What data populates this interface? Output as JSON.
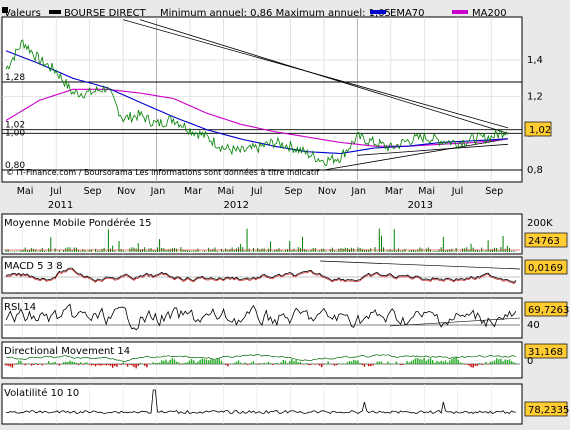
{
  "main": {
    "legend_label": "Valeurs",
    "series_name": "BOURSE DIRECT",
    "min_max_text": "Minimum annuel: 0,86 Maximum annuel: 1,05",
    "ema_label": "EMA70",
    "ma_label": "MA200",
    "copyright": "© IT-Finance.com / Boursorama Les informations sont données à titre indicatif",
    "y_ticks": [
      "1,4",
      "1,2",
      "1",
      "0,8"
    ],
    "annotations": [
      "1,28",
      "1,02",
      "1,00",
      "0,80"
    ],
    "last_value": "1,02",
    "colors": {
      "price": "#008000",
      "ema": "#0000cc",
      "ma": "#cc00cc",
      "highlight": "#ffcc33"
    }
  },
  "x_axis": {
    "months": [
      "Mai",
      "Jul",
      "Sep",
      "Nov",
      "Jan",
      "Mar",
      "Mai",
      "Jul",
      "Sep",
      "Nov",
      "Jan",
      "Mar",
      "Mai",
      "Jul",
      "Sep"
    ],
    "years": [
      "2011",
      "2012",
      "2013"
    ]
  },
  "panels": {
    "volume": {
      "title": "Moyenne Mobile Pondérée 15",
      "axis_label": "200K",
      "value": "24763"
    },
    "macd": {
      "title": "MACD 5 3 8",
      "value": "0,0169"
    },
    "rsi": {
      "title": "RSI 14",
      "axis_label": "40",
      "value": "69,7263"
    },
    "dm": {
      "title": "Directional Movement 14",
      "axis_label": "0",
      "value": "31,168"
    },
    "vol": {
      "title": "Volatilité 10 10",
      "value": "78,2335"
    }
  },
  "chart_data": [
    {
      "type": "line",
      "title": "",
      "series": [
        {
          "name": "BOURSE DIRECT",
          "points": [
            [
              "2011-04",
              1.35
            ],
            [
              "2011-05",
              1.5
            ],
            [
              "2011-06",
              1.4
            ],
            [
              "2011-07",
              1.34
            ],
            [
              "2011-08",
              1.22
            ],
            [
              "2011-09",
              1.22
            ],
            [
              "2011-10",
              1.25
            ],
            [
              "2011-11",
              1.08
            ],
            [
              "2011-12",
              1.1
            ],
            [
              "2012-01",
              1.05
            ],
            [
              "2012-02",
              1.08
            ],
            [
              "2012-03",
              1.02
            ],
            [
              "2012-04",
              0.98
            ],
            [
              "2012-05",
              0.92
            ],
            [
              "2012-06",
              0.9
            ],
            [
              "2012-07",
              0.92
            ],
            [
              "2012-08",
              0.95
            ],
            [
              "2012-09",
              0.93
            ],
            [
              "2012-10",
              0.89
            ],
            [
              "2012-11",
              0.85
            ],
            [
              "2012-12",
              0.87
            ],
            [
              "2013-01",
              0.98
            ],
            [
              "2013-02",
              0.95
            ],
            [
              "2013-03",
              0.92
            ],
            [
              "2013-04",
              0.96
            ],
            [
              "2013-05",
              0.98
            ],
            [
              "2013-06",
              0.96
            ],
            [
              "2013-07",
              0.95
            ],
            [
              "2013-08",
              0.97
            ],
            [
              "2013-09",
              0.98
            ],
            [
              "2013-10",
              1.02
            ]
          ]
        },
        {
          "name": "EMA70",
          "points": [
            [
              "2011-04",
              1.45
            ],
            [
              "2011-06",
              1.38
            ],
            [
              "2011-08",
              1.3
            ],
            [
              "2011-10",
              1.25
            ],
            [
              "2011-12",
              1.17
            ],
            [
              "2012-02",
              1.09
            ],
            [
              "2012-04",
              1.02
            ],
            [
              "2012-06",
              0.97
            ],
            [
              "2012-08",
              0.93
            ],
            [
              "2012-10",
              0.9
            ],
            [
              "2012-12",
              0.89
            ],
            [
              "2013-02",
              0.92
            ],
            [
              "2013-04",
              0.93
            ],
            [
              "2013-06",
              0.95
            ],
            [
              "2013-08",
              0.96
            ],
            [
              "2013-10",
              0.97
            ]
          ]
        },
        {
          "name": "MA200",
          "points": [
            [
              "2011-04",
              1.07
            ],
            [
              "2011-06",
              1.18
            ],
            [
              "2011-08",
              1.24
            ],
            [
              "2011-10",
              1.24
            ],
            [
              "2011-12",
              1.22
            ],
            [
              "2012-02",
              1.19
            ],
            [
              "2012-04",
              1.11
            ],
            [
              "2012-06",
              1.05
            ],
            [
              "2012-08",
              1.01
            ],
            [
              "2012-10",
              0.98
            ],
            [
              "2012-12",
              0.95
            ],
            [
              "2013-02",
              0.93
            ],
            [
              "2013-04",
              0.93
            ],
            [
              "2013-06",
              0.94
            ],
            [
              "2013-08",
              0.95
            ],
            [
              "2013-10",
              0.97
            ]
          ]
        }
      ],
      "horizontal_levels": [
        1.28,
        1.02,
        1.0,
        0.8
      ],
      "ylim": [
        0.8,
        1.58
      ],
      "y_ticks": [
        1.4,
        1.2,
        1.0,
        0.8
      ],
      "x_range": [
        "2011-04",
        "2013-10"
      ],
      "grid": true
    },
    {
      "type": "bar",
      "title": "Moyenne Mobile Pondérée 15",
      "last_value": 24763
    },
    {
      "type": "line",
      "title": "MACD 5 3 8",
      "last_value": 0.0169
    },
    {
      "type": "line",
      "title": "RSI 14",
      "last_value": 69.7263,
      "y_ticks": [
        40
      ]
    },
    {
      "type": "area",
      "title": "Directional Movement 14",
      "last_value": 31.168,
      "y_ticks": [
        0
      ]
    },
    {
      "type": "line",
      "title": "Volatilité 10 10",
      "last_value": 78.2335
    }
  ]
}
